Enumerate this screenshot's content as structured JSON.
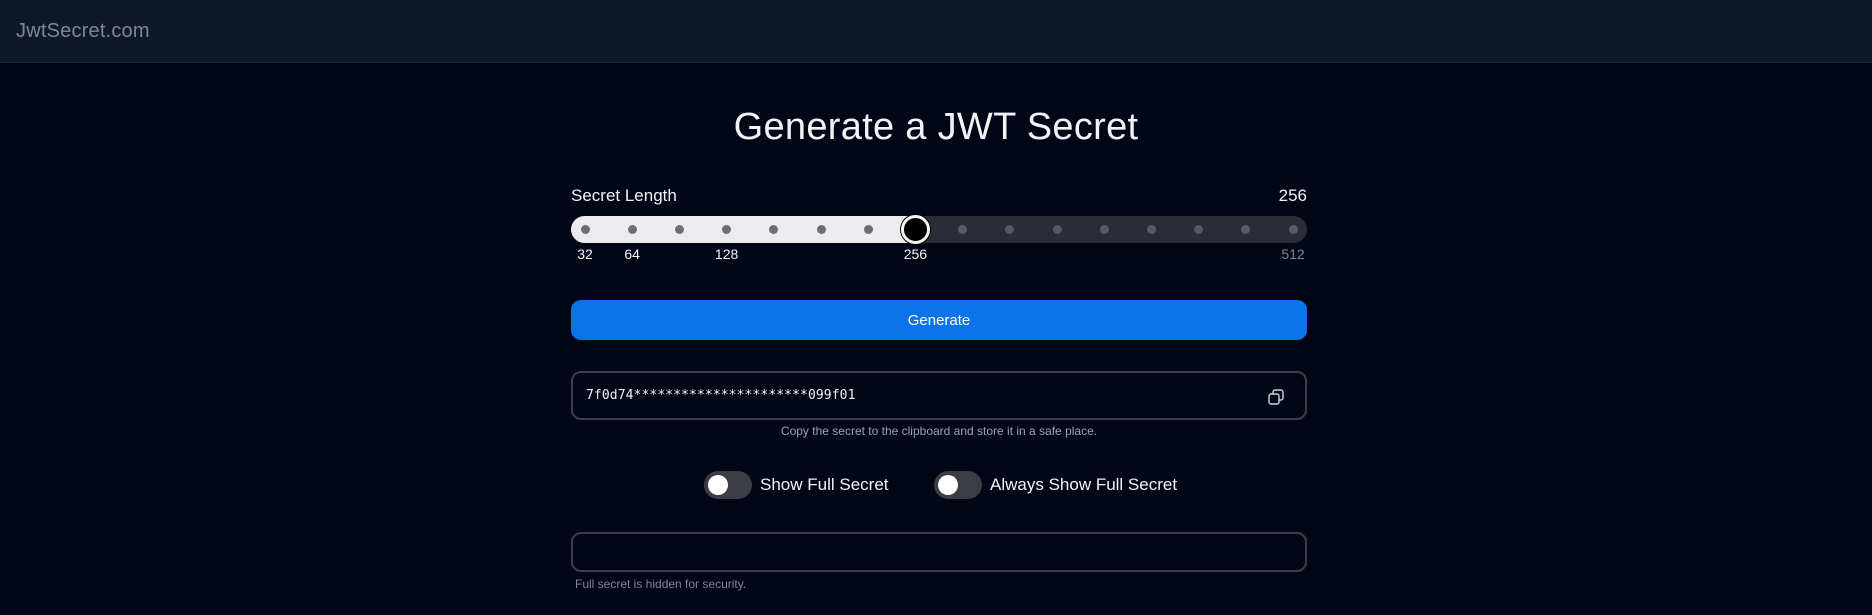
{
  "header": {
    "brand": "JwtSecret.com"
  },
  "main": {
    "title": "Generate a JWT Secret",
    "secret_length": {
      "label": "Secret Length",
      "value": "256",
      "ticks": [
        "32",
        "64",
        "128",
        "256",
        "512"
      ],
      "selected_index": 7,
      "step_count": 16
    },
    "generate_label": "Generate",
    "secret": {
      "masked_value": "7f0d74**********************099f01",
      "hint": "Copy the secret to the clipboard and store it in a safe place."
    },
    "toggles": {
      "show_full": {
        "label": "Show Full Secret",
        "on": false
      },
      "always_show_full": {
        "label": "Always Show Full Secret",
        "on": false
      }
    },
    "full_secret": {
      "value": "",
      "hint": "Full secret is hidden for security."
    },
    "icons": {
      "copy": "copy-icon"
    },
    "colors": {
      "accent": "#0a74e8",
      "background": "#020617",
      "topbar": "#0f1729"
    }
  }
}
